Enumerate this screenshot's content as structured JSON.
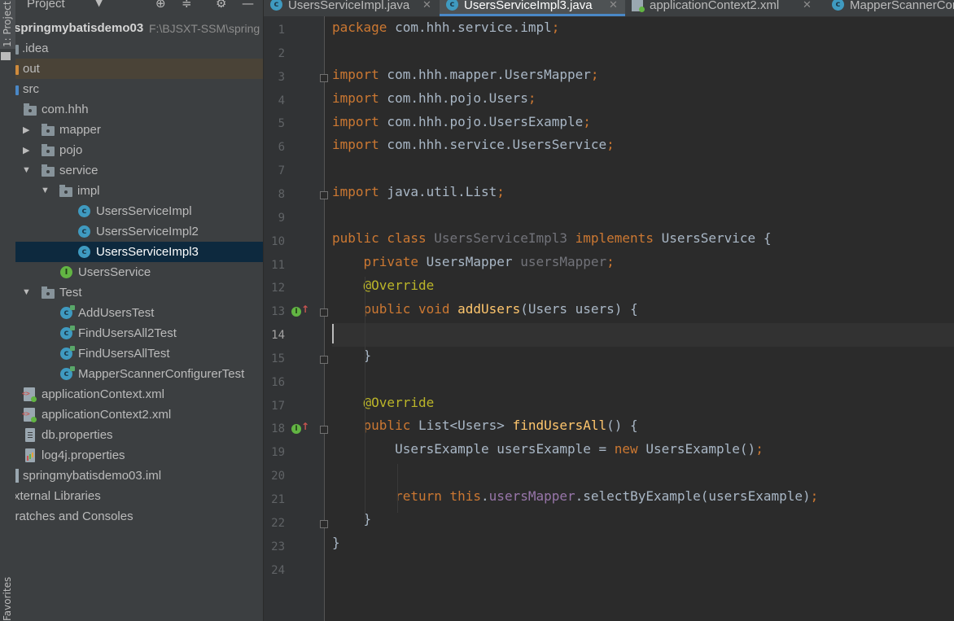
{
  "toolstrip": {
    "project_tab": "1: Project",
    "favorites_tab": "Favorites"
  },
  "project_panel": {
    "title": "Project",
    "header_icons": [
      "target-icon",
      "collapse-icon",
      "gear-icon",
      "minimize-icon"
    ],
    "root": {
      "name": "springmybatisdemo03",
      "path": "F:\\BJSXT-SSM\\spring"
    },
    "items": [
      {
        "label": ".idea"
      },
      {
        "label": "out"
      },
      {
        "label": "src"
      },
      {
        "label": "com.hhh"
      },
      {
        "label": "mapper"
      },
      {
        "label": "pojo"
      },
      {
        "label": "service"
      },
      {
        "label": "impl"
      },
      {
        "label": "UsersServiceImpl"
      },
      {
        "label": "UsersServiceImpl2"
      },
      {
        "label": "UsersServiceImpl3"
      },
      {
        "label": "UsersService"
      },
      {
        "label": "Test"
      },
      {
        "label": "AddUsersTest"
      },
      {
        "label": "FindUsersAll2Test"
      },
      {
        "label": "FindUsersAllTest"
      },
      {
        "label": "MapperScannerConfigurerTest"
      },
      {
        "label": "applicationContext.xml"
      },
      {
        "label": "applicationContext2.xml"
      },
      {
        "label": "db.properties"
      },
      {
        "label": "log4j.properties"
      },
      {
        "label": "springmybatisdemo03.iml"
      },
      {
        "label": "External Libraries"
      },
      {
        "label": "Scratches and Consoles"
      }
    ]
  },
  "editor": {
    "tabs": [
      {
        "label": "UsersServiceImpl.java",
        "active": false
      },
      {
        "label": "UsersServiceImpl3.java",
        "active": true
      },
      {
        "label": "applicationContext2.xml",
        "active": false
      },
      {
        "label": "MapperScannerConfigurerTest.java",
        "active": false
      }
    ],
    "line_numbers": [
      "1",
      "2",
      "3",
      "4",
      "5",
      "6",
      "7",
      "8",
      "9",
      "10",
      "11",
      "12",
      "13",
      "14",
      "15",
      "16",
      "17",
      "18",
      "19",
      "20",
      "21",
      "22",
      "23",
      "24"
    ],
    "current_line": "14",
    "code": {
      "l1a": "package",
      "l1b": " com.hhh.service.impl",
      "l1c": ";",
      "l3a": "import",
      "l3b": " com.hhh.mapper.UsersMapper",
      "l3c": ";",
      "l4a": "import",
      "l4b": " com.hhh.pojo.Users",
      "l4c": ";",
      "l5a": "import",
      "l5b": " com.hhh.pojo.UsersExample",
      "l5c": ";",
      "l6a": "import",
      "l6b": " com.hhh.service.UsersService",
      "l6c": ";",
      "l8a": "import",
      "l8b": " java.util.List",
      "l8c": ";",
      "l10a": "public class",
      "l10b": " UsersServiceImpl3",
      "l10c": " implements",
      "l10d": " UsersService {",
      "l11a": "    private",
      "l11b": " UsersMapper ",
      "l11c": "usersMapper",
      "l11d": ";",
      "l12a": "    @Override",
      "l13a": "    public void",
      "l13b": " addUsers",
      "l13c": "(Users users) {",
      "l15a": "    }",
      "l17a": "    @Override",
      "l18a": "    public",
      "l18b": " List<Users> ",
      "l18c": "findUsersAll",
      "l18d": "() {",
      "l19a": "        UsersExample usersExample = ",
      "l19b": "new",
      "l19c": " UsersExample()",
      "l19d": ";",
      "l21a": "        return this",
      "l21b": ".",
      "l21c": "usersMapper",
      "l21d": ".selectByExample(usersExample)",
      "l21e": ";",
      "l22a": "    }",
      "l23a": "}"
    }
  }
}
